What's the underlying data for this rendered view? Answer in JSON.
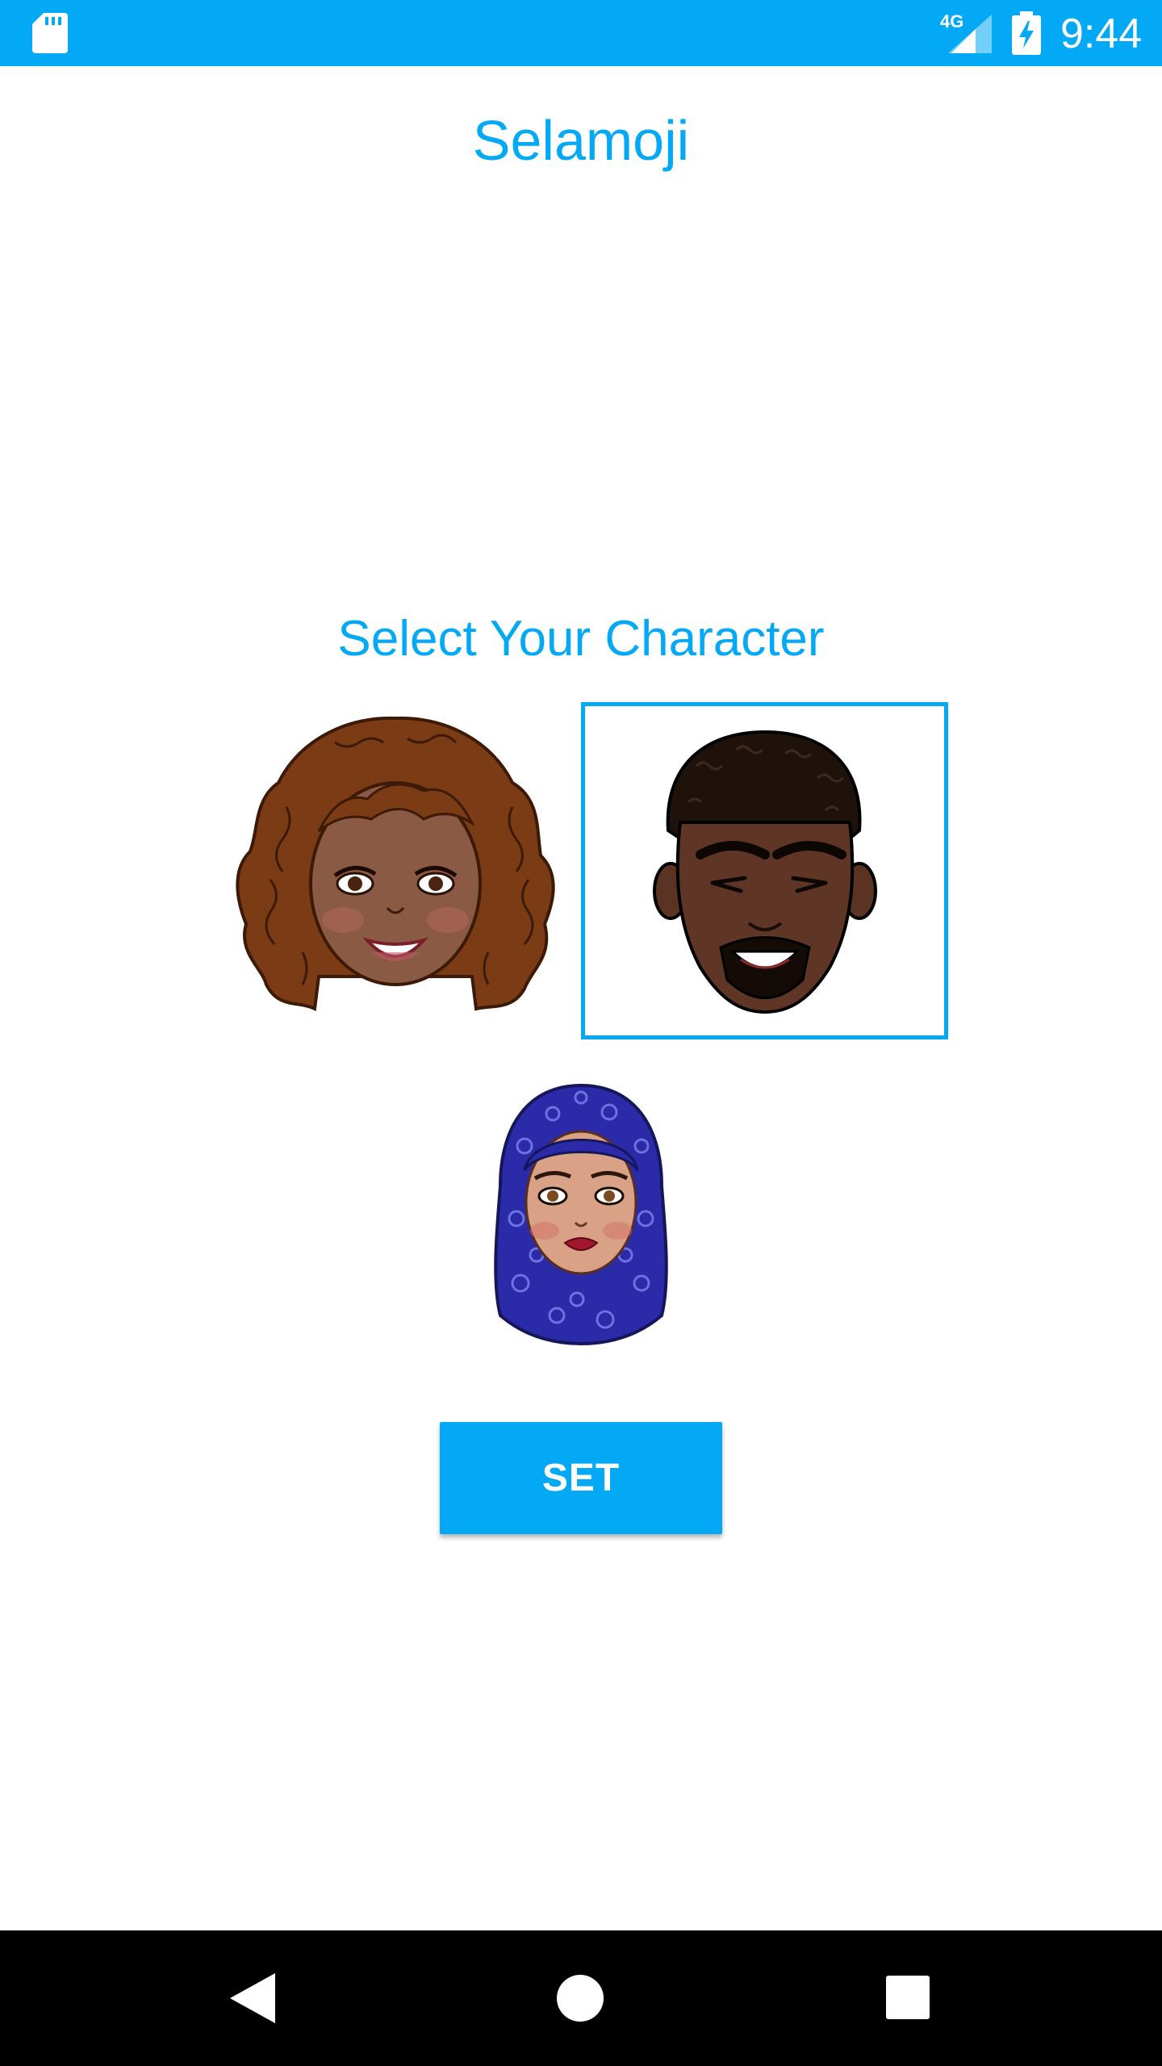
{
  "status_bar": {
    "network": "4G",
    "time": "9:44",
    "icons": [
      "sd-card-icon",
      "signal-icon",
      "battery-charging-icon"
    ],
    "color": "#03a9f4"
  },
  "app": {
    "title": "Selamoji",
    "accent_color": "#03a9f4"
  },
  "character_select": {
    "title": "Select Your Character",
    "characters": [
      {
        "name": "curly-hair-woman",
        "selected": false
      },
      {
        "name": "man-with-goatee",
        "selected": true
      },
      {
        "name": "hijab-woman",
        "selected": false
      }
    ]
  },
  "actions": {
    "set_label": "SET"
  },
  "nav_bar": {
    "icons": [
      "back-icon",
      "home-icon",
      "recent-apps-icon"
    ]
  }
}
